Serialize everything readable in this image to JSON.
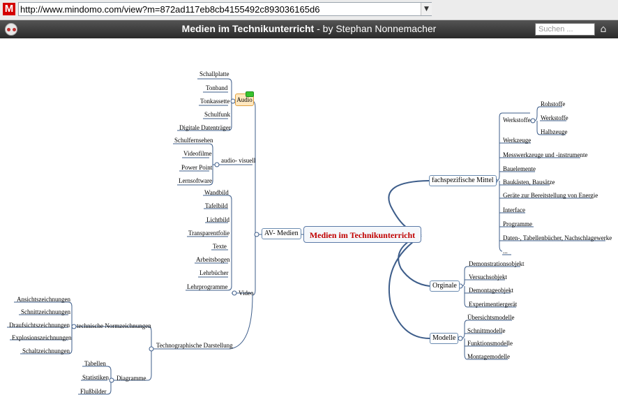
{
  "browser": {
    "logo": "M",
    "url": "http://www.mindomo.com/view?m=872ad117eb8cb4155492c893036165d6",
    "dropdown_icon": "chevron-down-icon"
  },
  "app": {
    "title_main": "Medien im Technikunterricht",
    "title_rest": " - by Stephan Nonnemacher",
    "search_placeholder": "Suchen ...",
    "home_icon": "home-icon"
  },
  "map": {
    "central": "Medien im Technikunterricht",
    "av_medien": "AV- Medien",
    "audio": "Audio",
    "audio_items": [
      "Schallplatte",
      "Tonband",
      "Tonkassette",
      "Schulfunk",
      "Digitale Datenträger"
    ],
    "audio_visuell": "audio- visuell",
    "audio_visuell_items": [
      "Schulfernsehen",
      "Videofilme",
      "Power Point",
      "Lernsoftware"
    ],
    "video": "Video",
    "video_items": [
      "Wandbild",
      "Tafelbild",
      "Lichtbild",
      "Transparentfolie",
      "Texte",
      "Arbeitsbogen",
      "Lehrbücher",
      "Lehrprogramme"
    ],
    "techno": "Technographische Darstellung",
    "normz": "technische Normzeichnungen",
    "normz_items": [
      "Ansichtszeichnungen",
      "Schnittzeichnungen",
      "Draufsichtszeichnungen",
      "Explosionszeichnungen",
      "Schaltzeichnungen"
    ],
    "diagramme": "Diagramme",
    "diagramme_items": [
      "Tabellen",
      "Statistiken",
      "Flußbilder"
    ],
    "fach": "fachspezifische Mittel",
    "werkstoffe": "Werkstoffe",
    "werkstoffe_items": [
      "Rohstoffe",
      "Werkstoffe",
      "Halbzeuge"
    ],
    "fach_items": [
      "Werkzeuge",
      "Messwerkzeuge und -instrumente",
      "Bauelemente",
      "Baukästen, Bausätze",
      "Geräte zur Bereitstellung von Energie",
      "Interface",
      "Programme",
      "Daten-, Tabellenbücher, Nachschlagewerke",
      "..."
    ],
    "orginale": "Orginale",
    "orginale_items": [
      "Demonstrationsobjekt",
      "Versuchsobjekt",
      "Demontageobjekt",
      "Experimentiergerät"
    ],
    "modelle": "Modelle",
    "modelle_items": [
      "Übersichtsmodelle",
      "Schnittmodelle",
      "Funktionsmodelle",
      "Montagemodelle"
    ]
  }
}
